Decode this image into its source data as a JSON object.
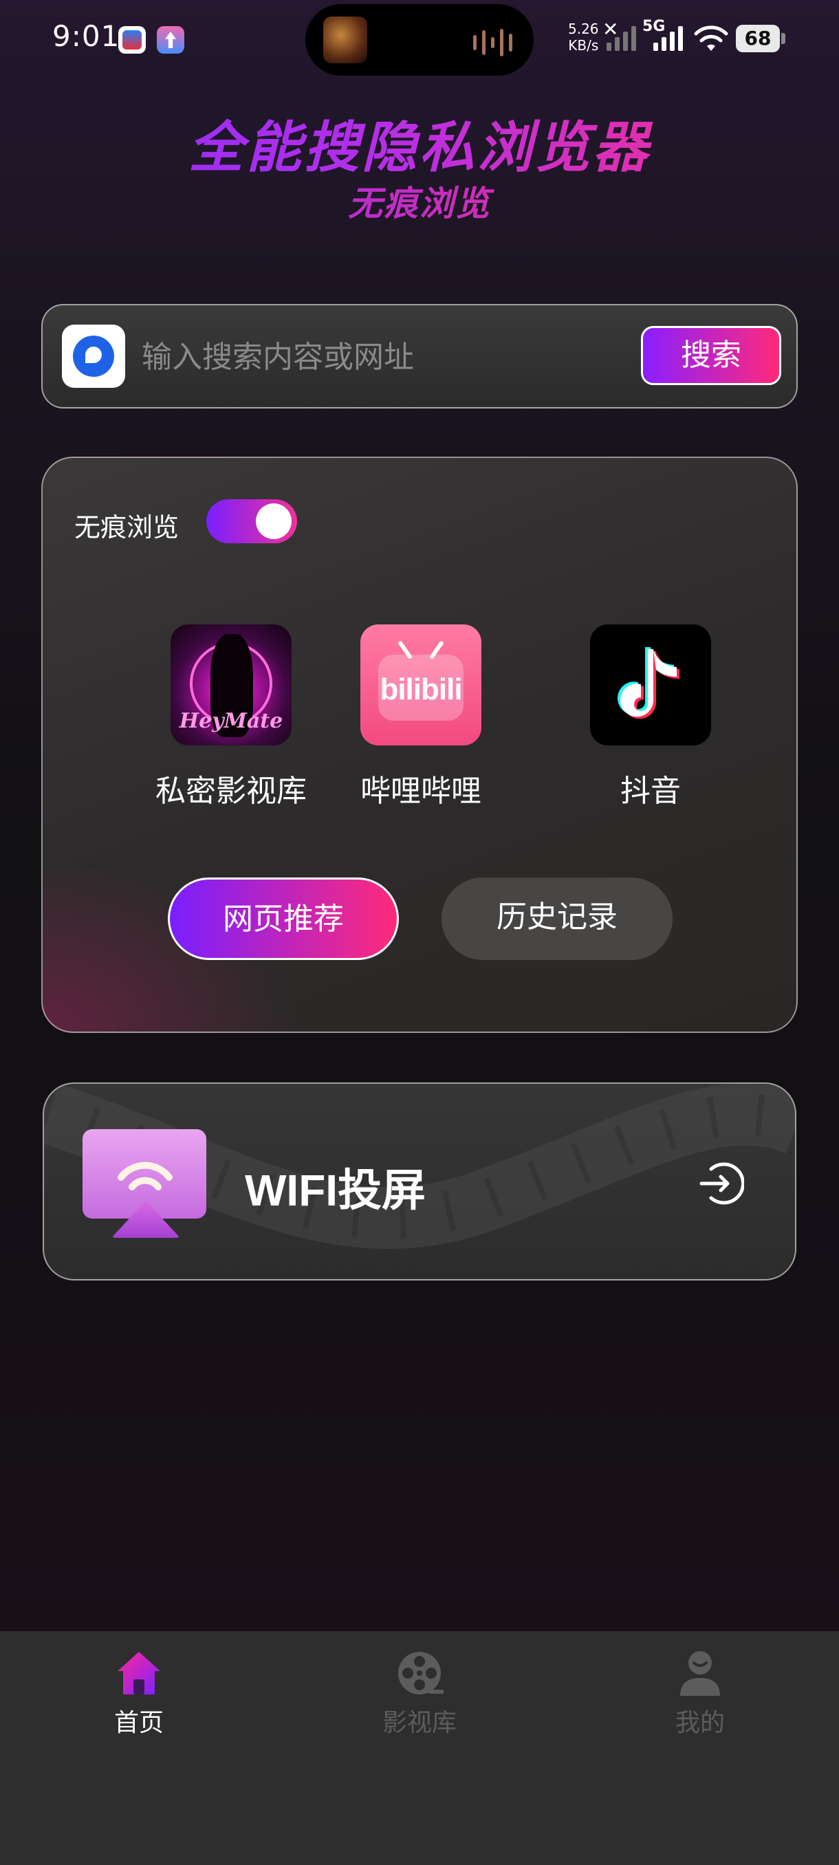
{
  "status_bar": {
    "time": "9:01",
    "net_speed_value": "5.26",
    "net_speed_unit": "KB/s",
    "network_type": "5G",
    "battery": "68"
  },
  "header": {
    "title": "全能搜隐私浏览器",
    "subtitle": "无痕浏览"
  },
  "search": {
    "placeholder": "输入搜索内容或网址",
    "value": "",
    "button_label": "搜索"
  },
  "main_card": {
    "incognito_label": "无痕浏览",
    "incognito_on": true,
    "shortcuts": [
      {
        "label": "私密影视库",
        "icon": "heymate-app-icon",
        "icon_text": "HeyMate"
      },
      {
        "label": "哔哩哔哩",
        "icon": "bilibili-app-icon",
        "icon_text": "bilibili"
      },
      {
        "label": "抖音",
        "icon": "tiktok-app-icon"
      }
    ],
    "buttons": {
      "recommend": "网页推荐",
      "history": "历史记录"
    }
  },
  "wifi_card": {
    "title": "WIFI投屏"
  },
  "bottom_nav": {
    "items": [
      {
        "label": "首页",
        "active": true,
        "icon": "home-icon"
      },
      {
        "label": "影视库",
        "active": false,
        "icon": "film-reel-icon"
      },
      {
        "label": "我的",
        "active": false,
        "icon": "user-icon"
      }
    ]
  },
  "colors": {
    "accent_start": "#8a1fff",
    "accent_end": "#ff2a7a",
    "background": "#111013",
    "card": "#2d2b2b",
    "nav_background": "#2e2e2e",
    "nav_inactive": "#5c5c5c"
  }
}
